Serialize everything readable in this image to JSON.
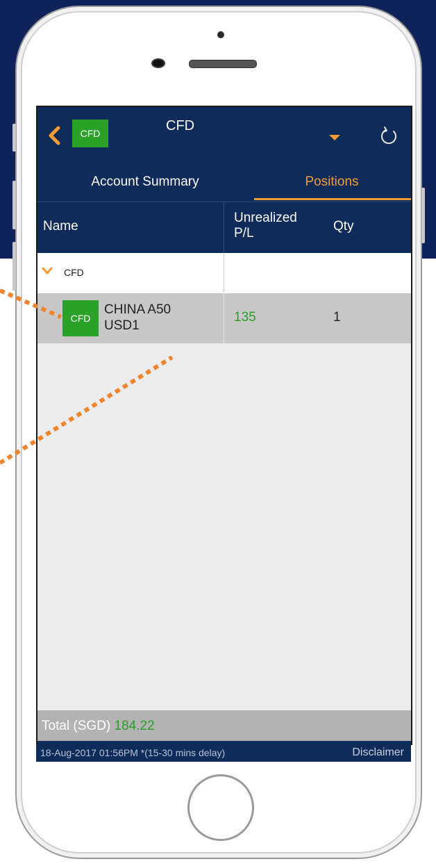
{
  "appbar": {
    "badge": "CFD",
    "title": "CFD"
  },
  "tabs": [
    {
      "label": "Account Summary",
      "active": false
    },
    {
      "label": "Positions",
      "active": true
    }
  ],
  "columns": {
    "name": "Name",
    "unrealized": "Unrealized P/L",
    "qty": "Qty"
  },
  "group": {
    "label": "CFD"
  },
  "positions": [
    {
      "badge": "CFD",
      "name_line1": "CHINA A50",
      "name_line2": "USD1",
      "unrealized_pl": "135",
      "qty": "1"
    }
  ],
  "total": {
    "label": "Total (SGD)",
    "value": "184.22"
  },
  "footer": {
    "timestamp": "18-Aug-2017 01:56PM *(15-30 mins delay)",
    "disclaimer": "Disclaimer"
  },
  "colors": {
    "navy": "#0f2b5a",
    "accent_orange": "#f39c33",
    "positive_green": "#2a9d2a",
    "badge_green": "#2aa229"
  },
  "icons": [
    "back-chevron-icon",
    "dropdown-caret-icon",
    "refresh-icon",
    "group-expand-chevron-icon"
  ]
}
